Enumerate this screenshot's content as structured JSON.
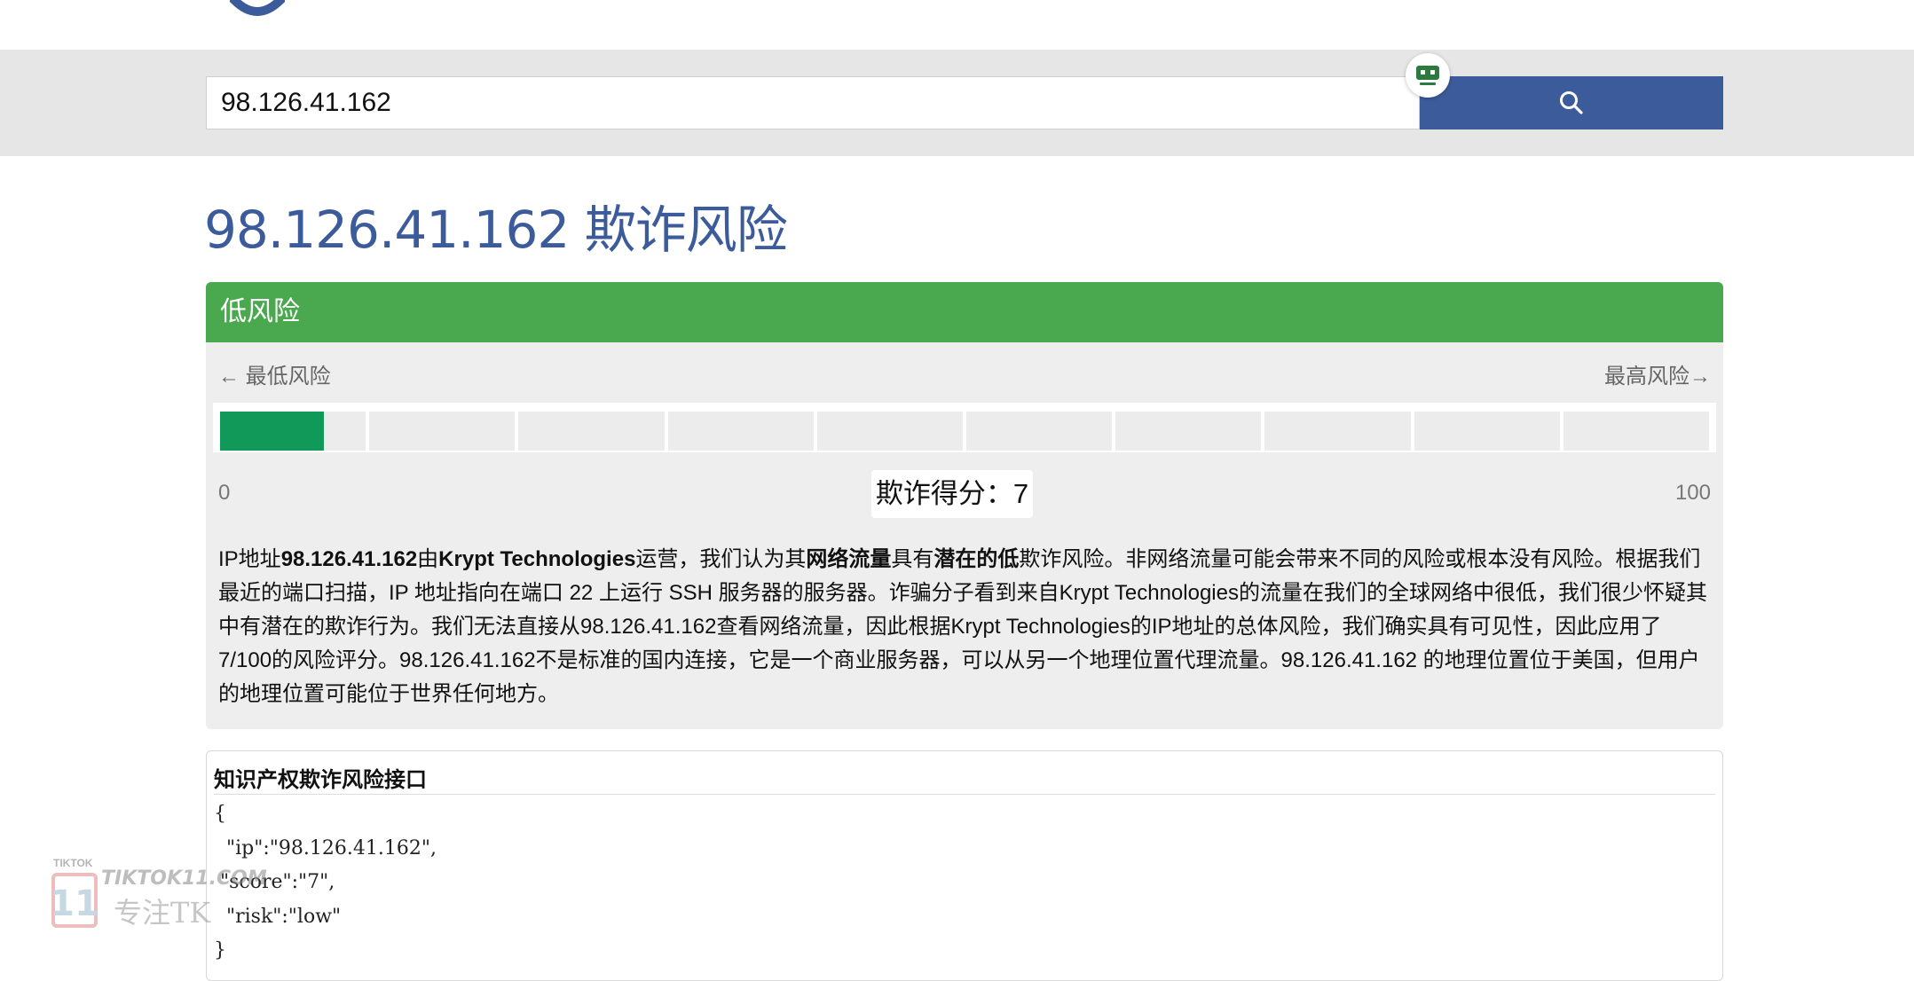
{
  "header": {
    "logo_icon": "shield-icon"
  },
  "search": {
    "value": "98.126.41.162",
    "button_icon": "search-icon",
    "badge_icon": "robot-icon"
  },
  "title": "98.126.41.162 欺诈风险",
  "risk": {
    "level_label": "低风险",
    "scale_low_label": "← 最低风险",
    "scale_high_label": "最高风险→",
    "min": "0",
    "max": "100",
    "score_label": "欺诈得分：7",
    "score_value": 7,
    "header_color": "#4aa84f",
    "fill_color": "#11995a"
  },
  "description": {
    "t1": "IP地址",
    "b1": "98.126.41.162",
    "t2": "由",
    "b2": "Krypt Technologies",
    "t3": "运营，我们认为其",
    "b3": "网络流量",
    "t4": "具有",
    "b4": "潜在的低",
    "t5": "欺诈风险。非网络流量可能会带来不同的风险或根本没有风险。根据我们最近的端口扫描，IP 地址指向在端口 22 上运行 SSH 服务器的服务器。诈骗分子看到来自Krypt Technologies的流量在我们的全球网络中很低，我们很少怀疑其中有潜在的欺诈行为。我们无法直接从98.126.41.162查看网络流量，因此根据Krypt Technologies的IP地址的总体风险，我们确实具有可见性，因此应用了7/100的风险评分。98.126.41.162不是标准的国内连接，它是一个商业服务器，可以从另一个地理位置代理流量。98.126.41.162 的地理位置位于美国，但用户的地理位置可能位于世界任何地方。"
  },
  "api": {
    "title": "知识产权欺诈风险接口",
    "code": "{\n  \"ip\":\"98.126.41.162\",\n \"score\":\"7\",\n  \"risk\":\"low\"\n}"
  },
  "watermark": {
    "small": "TIKTOK",
    "site": "TIKTOK11.COM",
    "tag": "专注TK",
    "logo_text": "11"
  }
}
